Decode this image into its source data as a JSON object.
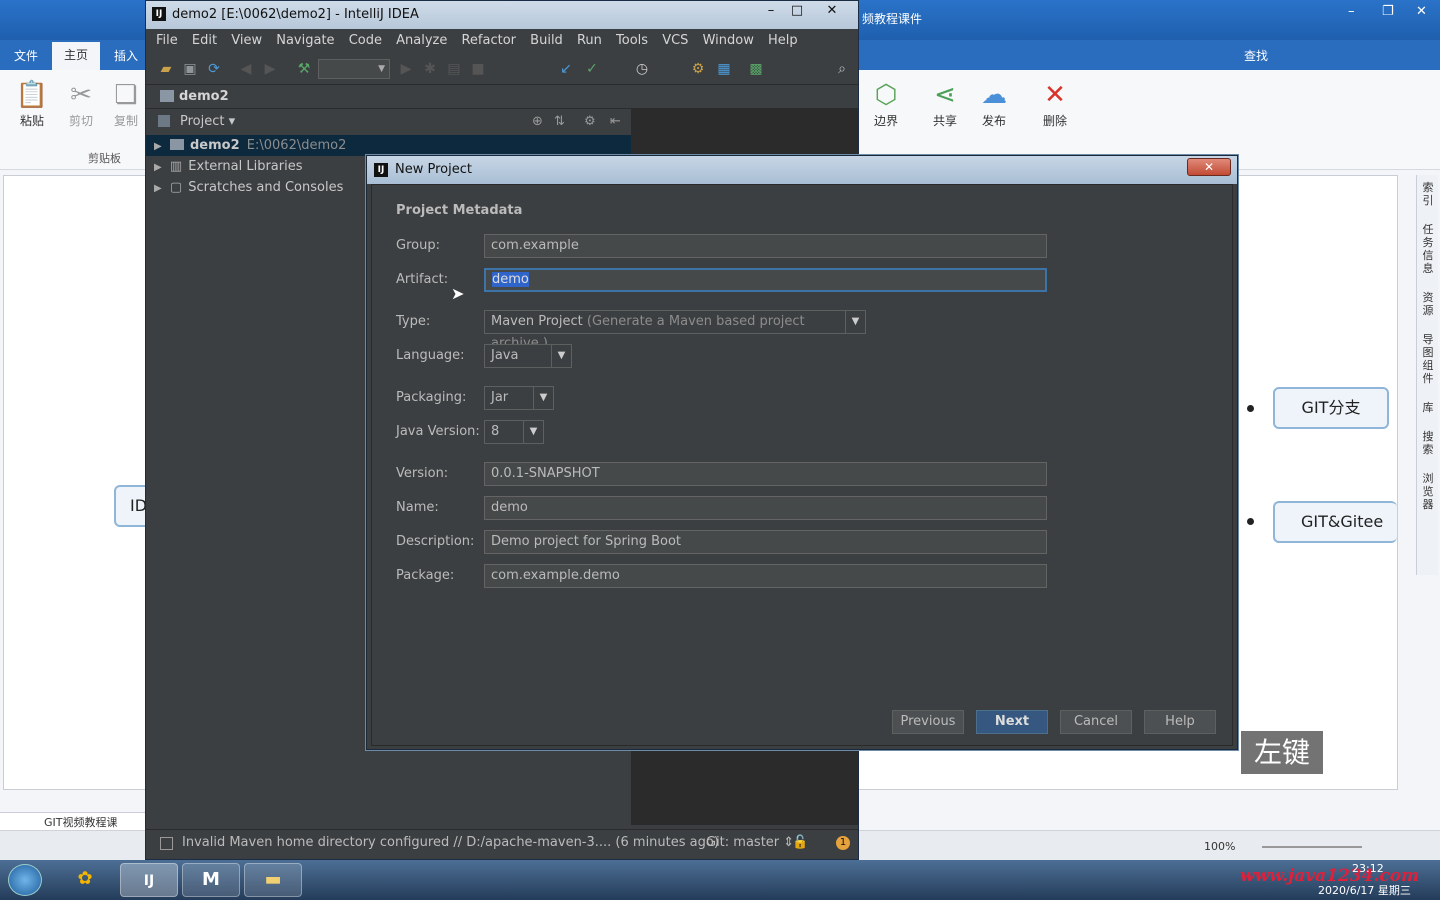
{
  "background_app": {
    "title_suffix": "频教程课件",
    "tabs": [
      "文件",
      "主页",
      "插入"
    ],
    "search_label": "查找",
    "ribbon_left": [
      {
        "label": "粘贴",
        "icon": "paste-icon"
      },
      {
        "label": "剪切",
        "icon": "cut-icon"
      },
      {
        "label": "复制",
        "icon": "copy-icon"
      }
    ],
    "clipboard_group": "剪贴板",
    "ribbon_right": [
      {
        "label": "边界",
        "icon": "boundary-icon"
      },
      {
        "label": "共享",
        "icon": "share-icon"
      },
      {
        "label": "发布",
        "icon": "publish-cloud-icon"
      },
      {
        "label": "删除",
        "icon": "delete-x-icon"
      }
    ],
    "nodes": {
      "left_partial": "ID",
      "git_branch": "GIT分支",
      "git_gitee": "GIT&Gitee基"
    },
    "right_rail": [
      "索引",
      "任务信息",
      "资源",
      "导图组件",
      "库",
      "搜索",
      "浏览器"
    ],
    "bottom_tab": "GIT视频教程课",
    "zoom": "100%"
  },
  "ij": {
    "window_title": "demo2 [E:\\0062\\demo2] - IntelliJ IDEA",
    "menu": [
      "File",
      "Edit",
      "View",
      "Navigate",
      "Code",
      "Analyze",
      "Refactor",
      "Build",
      "Run",
      "Tools",
      "VCS",
      "Window",
      "Help"
    ],
    "breadcrumb": "demo2",
    "project_dropdown": "Project",
    "tree": [
      {
        "name": "demo2",
        "path": "E:\\0062\\demo2"
      },
      {
        "name": "External Libraries"
      },
      {
        "name": "Scratches and Consoles"
      }
    ],
    "status_message": "Invalid Maven home directory configured // D:/apache-maven-3.... (6 minutes ago)",
    "git_branch": "Git: master",
    "notification_count": "1"
  },
  "dialog": {
    "title": "New Project",
    "section": "Project Metadata",
    "close_glyph": "✕",
    "fields": {
      "group": {
        "label": "Group:",
        "value": "com.example"
      },
      "artifact": {
        "label": "Artifact:",
        "value": "demo"
      },
      "type": {
        "label": "Type:",
        "value": "Maven Project",
        "hint": "(Generate a Maven based project archive.)"
      },
      "language": {
        "label": "Language:",
        "value": "Java"
      },
      "packaging": {
        "label": "Packaging:",
        "value": "Jar"
      },
      "java_version": {
        "label": "Java Version:",
        "value": "8"
      },
      "version": {
        "label": "Version:",
        "value": "0.0.1-SNAPSHOT"
      },
      "name": {
        "label": "Name:",
        "value": "demo"
      },
      "description": {
        "label": "Description:",
        "value": "Demo project for Spring Boot"
      },
      "package": {
        "label": "Package:",
        "value": "com.example.demo"
      }
    },
    "buttons": {
      "previous": "Previous",
      "next": "Next",
      "cancel": "Cancel",
      "help": "Help"
    }
  },
  "overlay_key": "左键",
  "taskbar": {
    "watermark": "www.java1234.com",
    "date": "2020/6/17 星期三",
    "time": "23:12"
  }
}
